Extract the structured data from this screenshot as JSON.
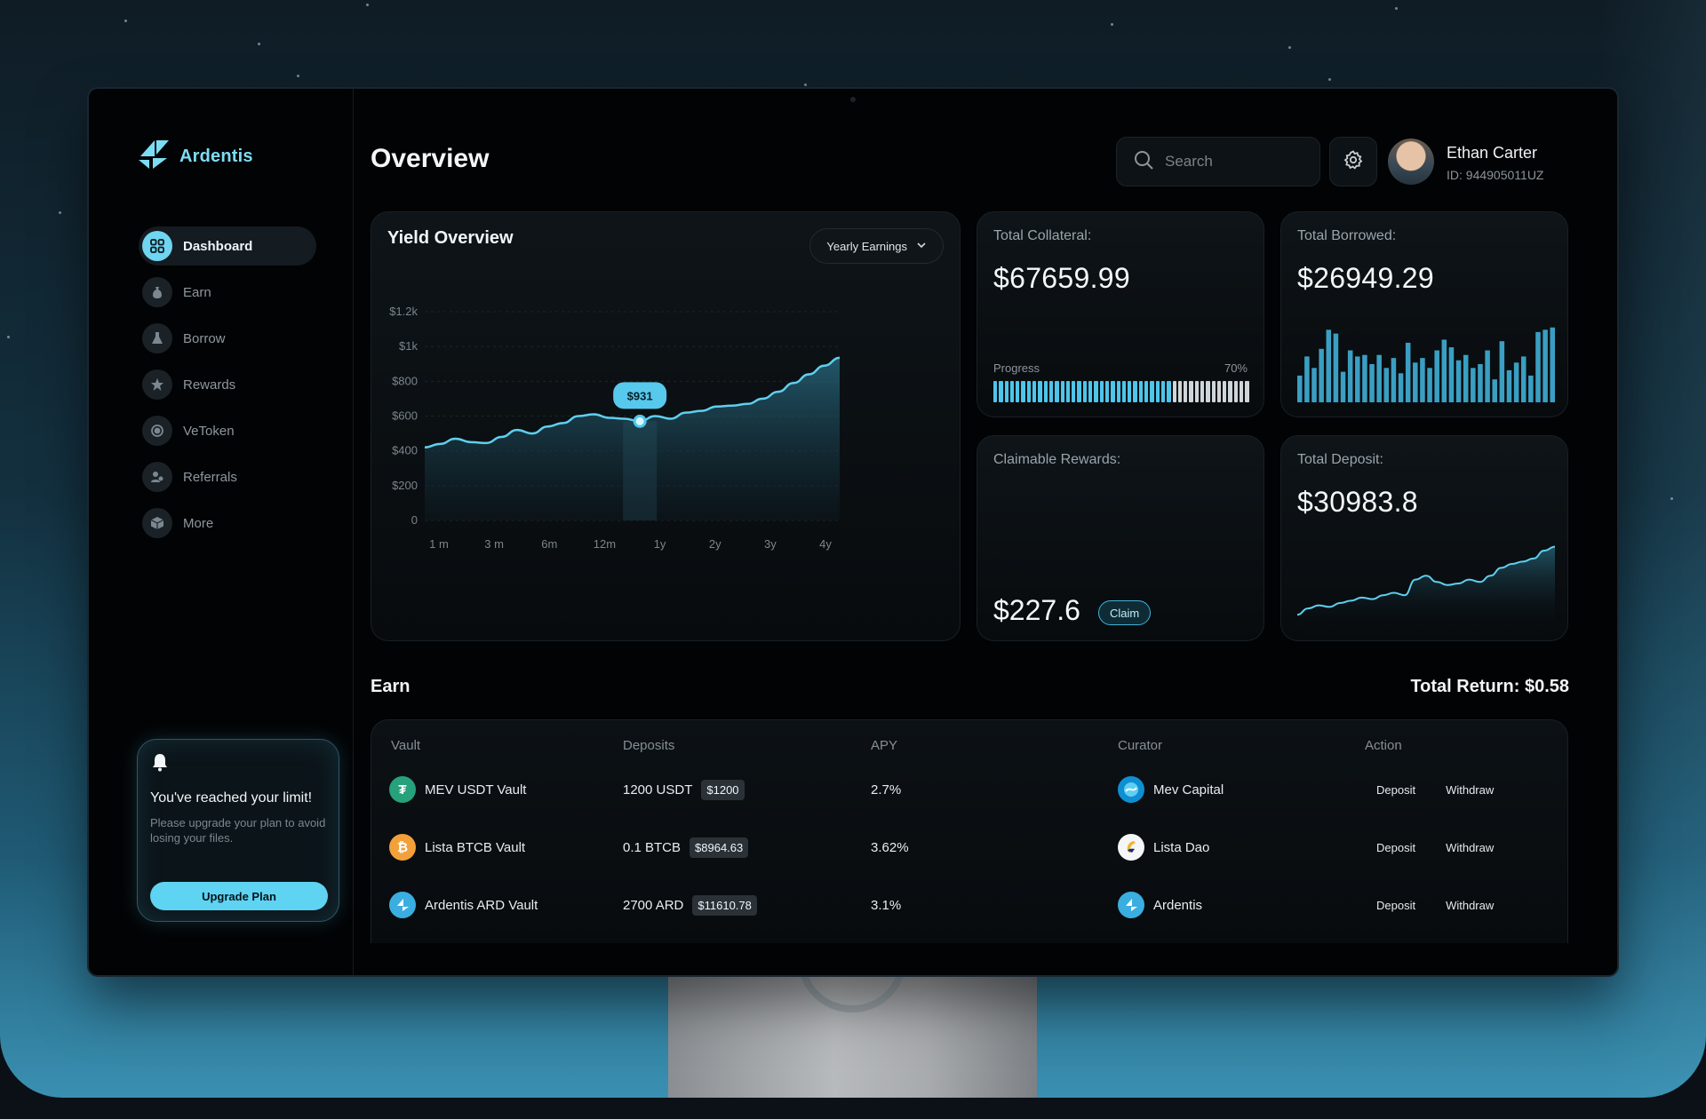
{
  "app": {
    "name": "Ardentis",
    "page_title": "Overview"
  },
  "sidebar": {
    "items": [
      {
        "label": "Dashboard",
        "icon": "grid-icon",
        "active": true
      },
      {
        "label": "Earn",
        "icon": "money-bag-icon",
        "active": false
      },
      {
        "label": "Borrow",
        "icon": "flask-icon",
        "active": false
      },
      {
        "label": "Rewards",
        "icon": "star-icon",
        "active": false
      },
      {
        "label": "VeToken",
        "icon": "token-icon",
        "active": false
      },
      {
        "label": "Referrals",
        "icon": "users-icon",
        "active": false
      },
      {
        "label": "More",
        "icon": "cube-icon",
        "active": false
      }
    ],
    "limit_card": {
      "title": "You've reached your limit!",
      "text": "Please upgrade your plan to avoid losing your files.",
      "button": "Upgrade Plan"
    }
  },
  "header": {
    "search_placeholder": "Search",
    "user": {
      "name": "Ethan Carter",
      "id": "ID: 944905011UZ"
    }
  },
  "yield": {
    "title": "Yield Overview",
    "dropdown": "Yearly Earnings",
    "tooltip": "$931"
  },
  "chart_data": {
    "type": "area",
    "x_ticks": [
      "1 m",
      "3 m",
      "6m",
      "12m",
      "1y",
      "2y",
      "3y",
      "4y"
    ],
    "y_ticks": [
      "0",
      "$200",
      "$400",
      "$600",
      "$800",
      "$1k",
      "$1.2k"
    ],
    "ylim": [
      0,
      1200
    ],
    "highlight_index": 14,
    "values": [
      420,
      440,
      470,
      450,
      445,
      480,
      520,
      500,
      540,
      560,
      600,
      610,
      590,
      585,
      570,
      600,
      585,
      620,
      630,
      655,
      660,
      670,
      700,
      740,
      790,
      840,
      890,
      935
    ]
  },
  "stats": {
    "collateral": {
      "label": "Total Collateral:",
      "value": "$67659.99",
      "progress_label": "Progress",
      "progress_text": "70%",
      "progress": 0.7
    },
    "borrowed": {
      "label": "Total Borrowed:",
      "value": "$26949.29",
      "bars": [
        0.35,
        0.6,
        0.45,
        0.7,
        0.95,
        0.9,
        0.4,
        0.68,
        0.6,
        0.62,
        0.5,
        0.62,
        0.45,
        0.58,
        0.38,
        0.78,
        0.52,
        0.58,
        0.45,
        0.68,
        0.82,
        0.72,
        0.55,
        0.62,
        0.45,
        0.5,
        0.68,
        0.3,
        0.8,
        0.42,
        0.52,
        0.6,
        0.35,
        0.92,
        0.95,
        0.98
      ]
    },
    "rewards": {
      "label": "Claimable Rewards:",
      "value": "$227.6",
      "button": "Claim"
    },
    "deposit": {
      "label": "Total Deposit:",
      "value": "$30983.8",
      "series": [
        0.1,
        0.18,
        0.22,
        0.2,
        0.25,
        0.28,
        0.32,
        0.3,
        0.35,
        0.38,
        0.35,
        0.55,
        0.6,
        0.52,
        0.48,
        0.5,
        0.55,
        0.52,
        0.6,
        0.7,
        0.75,
        0.78,
        0.82,
        0.92,
        0.97
      ]
    }
  },
  "earn": {
    "title": "Earn",
    "total_return": "Total Return: $0.58",
    "columns": [
      "Vault",
      "Deposits",
      "APY",
      "Curator",
      "Action"
    ],
    "rows": [
      {
        "vault": "MEV USDT Vault",
        "coin": "tether-icon",
        "coin_color": "#26a17b",
        "coin_glyph": "₮",
        "deposit": "1200 USDT",
        "deposit_usd": "$1200",
        "apy": "2.7%",
        "curator": "Mev Capital",
        "curator_icon": "mev-capital-icon",
        "deposit_btn": "Deposit",
        "withdraw_btn": "Withdraw"
      },
      {
        "vault": "Lista BTCB Vault",
        "coin": "bitcoin-icon",
        "coin_color": "#f2a03a",
        "coin_glyph": "₿",
        "deposit": "0.1 BTCB",
        "deposit_usd": "$8964.63",
        "apy": "3.62%",
        "curator": "Lista Dao",
        "curator_icon": "lista-dao-icon",
        "deposit_btn": "Deposit",
        "withdraw_btn": "Withdraw"
      },
      {
        "vault": "Ardentis ARD Vault",
        "coin": "ardentis-icon",
        "coin_color": "#3aaee0",
        "coin_glyph": "◆",
        "deposit": "2700 ARD",
        "deposit_usd": "$11610.78",
        "apy": "3.1%",
        "curator": "Ardentis",
        "curator_icon": "ardentis-icon",
        "deposit_btn": "Deposit",
        "withdraw_btn": "Withdraw"
      }
    ]
  }
}
